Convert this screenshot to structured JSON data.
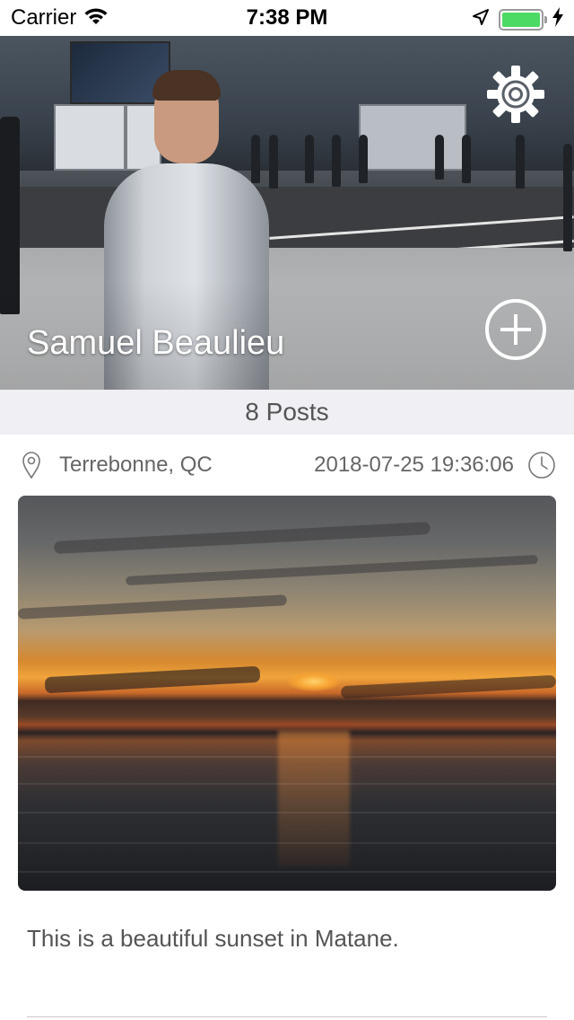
{
  "status_bar": {
    "carrier": "Carrier",
    "time": "7:38 PM",
    "battery_level": 1.0
  },
  "profile": {
    "name": "Samuel Beaulieu",
    "settings_icon": "gear-icon",
    "add_icon": "plus-circle-icon"
  },
  "posts_bar": {
    "label": "8 Posts"
  },
  "post": {
    "location": "Terrebonne, QC",
    "date": "2018-07-25 19:36:06",
    "caption": "This is a beautiful sunset in Matane.",
    "location_icon": "map-pin-icon",
    "clock_icon": "clock-icon"
  },
  "colors": {
    "accent": "#4cd964",
    "posts_bar_bg": "#efeff4",
    "meta_text": "#666666"
  }
}
